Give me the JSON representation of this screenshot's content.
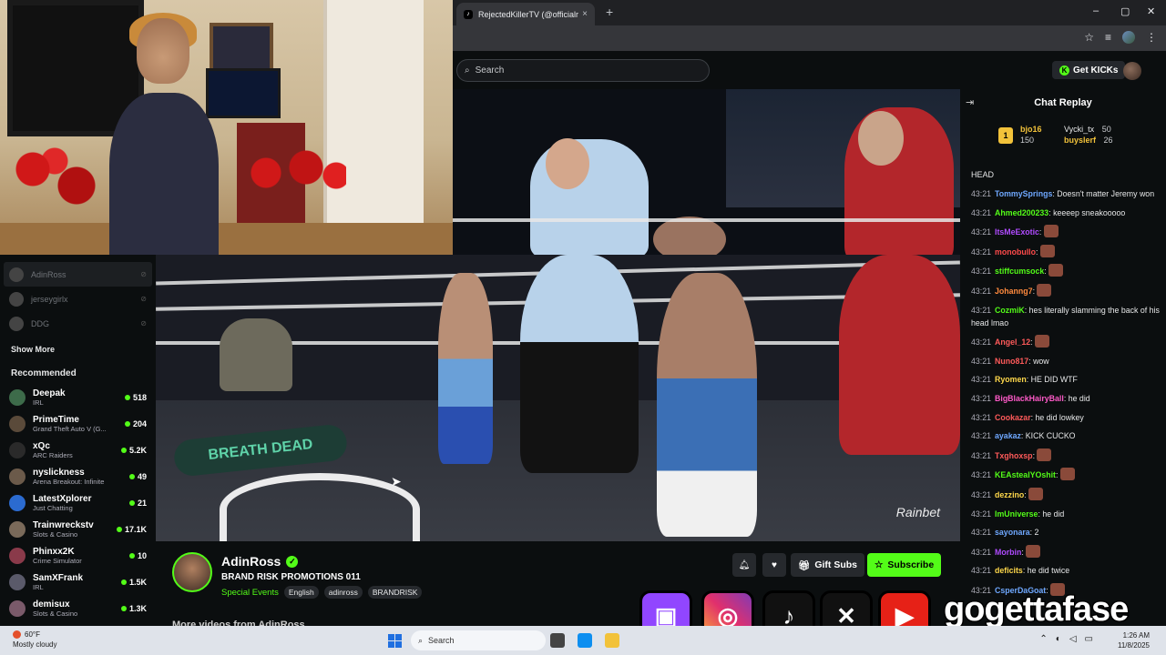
{
  "browser": {
    "tab_title": "RejectedKillerTV (@officialreject",
    "tab_close": "×",
    "new_tab": "+",
    "window_controls": [
      "–",
      "▢",
      "✕"
    ]
  },
  "kick": {
    "search_placeholder": "Search",
    "get_kicks_label": "Get KICKs"
  },
  "sidebar": {
    "following": [
      {
        "name": "AdinRoss"
      },
      {
        "name": "jerseygirlx"
      },
      {
        "name": "DDG"
      }
    ],
    "show_more": "Show More",
    "recommended_title": "Recommended",
    "recommended": [
      {
        "name": "Deepak",
        "category": "IRL",
        "viewers": "518",
        "color": "#3d6b4a"
      },
      {
        "name": "PrimeTime",
        "category": "Grand Theft Auto V (G...",
        "viewers": "204",
        "color": "#5a4a3a"
      },
      {
        "name": "xQc",
        "category": "ARC Raiders",
        "viewers": "5.2K",
        "color": "#2a2a2a"
      },
      {
        "name": "nyslickness",
        "category": "Arena Breakout: Infinite",
        "viewers": "49",
        "color": "#6b5a4a"
      },
      {
        "name": "LatestXplorer",
        "category": "Just Chatting",
        "viewers": "21",
        "color": "#2b6bd0"
      },
      {
        "name": "Trainwreckstv",
        "category": "Slots & Casino",
        "viewers": "17.1K",
        "color": "#7a6a5a"
      },
      {
        "name": "Phinxx2K",
        "category": "Crime Simulator",
        "viewers": "10",
        "color": "#8a3a4a"
      },
      {
        "name": "SamXFrank",
        "category": "IRL",
        "viewers": "1.5K",
        "color": "#5a5a6a"
      },
      {
        "name": "demisux",
        "category": "Slots & Casino",
        "viewers": "1.3K",
        "color": "#7a5a6a"
      }
    ]
  },
  "video": {
    "watermark": "Rainbet",
    "promo_logo": "BREATH DEAD"
  },
  "stream": {
    "channel_name": "AdinRoss",
    "title": "BRAND RISK PROMOTIONS 011",
    "category": "Special Events",
    "tags": [
      "English",
      "adinross",
      "BRANDRISK"
    ],
    "more_videos": "More videos from AdinRoss",
    "gift_subs_label": "Gift Subs",
    "subscribe_label": "Subscribe"
  },
  "chat": {
    "title": "Chat Replay",
    "leaderboard": [
      {
        "name": "bjo16",
        "amount": "150"
      },
      {
        "name": "Vycki_tx",
        "amount": "50"
      },
      {
        "name": "buyslerf",
        "amount": "26"
      }
    ],
    "head_label": "HEAD",
    "messages": [
      {
        "time": "43:21",
        "user": "TommySprings",
        "color": "#6fa8ff",
        "text": "Doesn't matter Jeremy won",
        "emote": false
      },
      {
        "time": "43:21",
        "user": "Ahmed200233",
        "color": "#53fc18",
        "text": "keeeep sneakooooo",
        "emote": false
      },
      {
        "time": "43:21",
        "user": "ItsMeExotic",
        "color": "#b04bff",
        "text": "",
        "emote": true
      },
      {
        "time": "43:21",
        "user": "monobullo",
        "color": "#ff4b4b",
        "text": "",
        "emote": true
      },
      {
        "time": "43:21",
        "user": "stiffcumsock",
        "color": "#53fc18",
        "text": "",
        "emote": true
      },
      {
        "time": "43:21",
        "user": "Johanng7",
        "color": "#ff8a3d",
        "text": "",
        "emote": true
      },
      {
        "time": "43:21",
        "user": "CozmiK",
        "color": "#53fc18",
        "text": "hes literally slamming the back of his head lmao",
        "emote": false
      },
      {
        "time": "43:21",
        "user": "Angel_12",
        "color": "#ff5a5a",
        "text": "",
        "emote": true
      },
      {
        "time": "43:21",
        "user": "Nuno817",
        "color": "#ff5a5a",
        "text": "wow",
        "emote": false
      },
      {
        "time": "43:21",
        "user": "Ryomen",
        "color": "#ffd84b",
        "text": "HE DID WTF",
        "emote": false
      },
      {
        "time": "43:21",
        "user": "BigBlackHairyBall",
        "color": "#ff5ac8",
        "text": "he did",
        "emote": false
      },
      {
        "time": "43:21",
        "user": "Cookazar",
        "color": "#ff5a5a",
        "text": "he did lowkey",
        "emote": false
      },
      {
        "time": "43:21",
        "user": "ayakaz",
        "color": "#6fa8ff",
        "text": "KICK CUCKO",
        "emote": false
      },
      {
        "time": "43:21",
        "user": "Txghoxsp",
        "color": "#ff5a5a",
        "text": "",
        "emote": true
      },
      {
        "time": "43:21",
        "user": "KEAstealYOshit",
        "color": "#53fc18",
        "text": "",
        "emote": true
      },
      {
        "time": "43:21",
        "user": "dezzino",
        "color": "#ffd84b",
        "text": "",
        "emote": true
      },
      {
        "time": "43:21",
        "user": "ImUniverse",
        "color": "#53fc18",
        "text": "he did",
        "emote": false
      },
      {
        "time": "43:21",
        "user": "sayonara",
        "color": "#6fa8ff",
        "text": "2",
        "emote": false
      },
      {
        "time": "43:21",
        "user": "Morbin",
        "color": "#b04bff",
        "text": "",
        "emote": true
      },
      {
        "time": "43:21",
        "user": "deficits",
        "color": "#ffd84b",
        "text": "he did twice",
        "emote": false
      },
      {
        "time": "43:21",
        "user": "CsperDaGoat",
        "color": "#6fa8ff",
        "text": "",
        "emote": true
      }
    ]
  },
  "overlay": {
    "social_handle": "gogettafase"
  },
  "taskbar": {
    "temperature": "60°F",
    "weather": "Mostly cloudy",
    "search_placeholder": "Search",
    "time": "1:26 AM",
    "date": "11/8/2025"
  }
}
